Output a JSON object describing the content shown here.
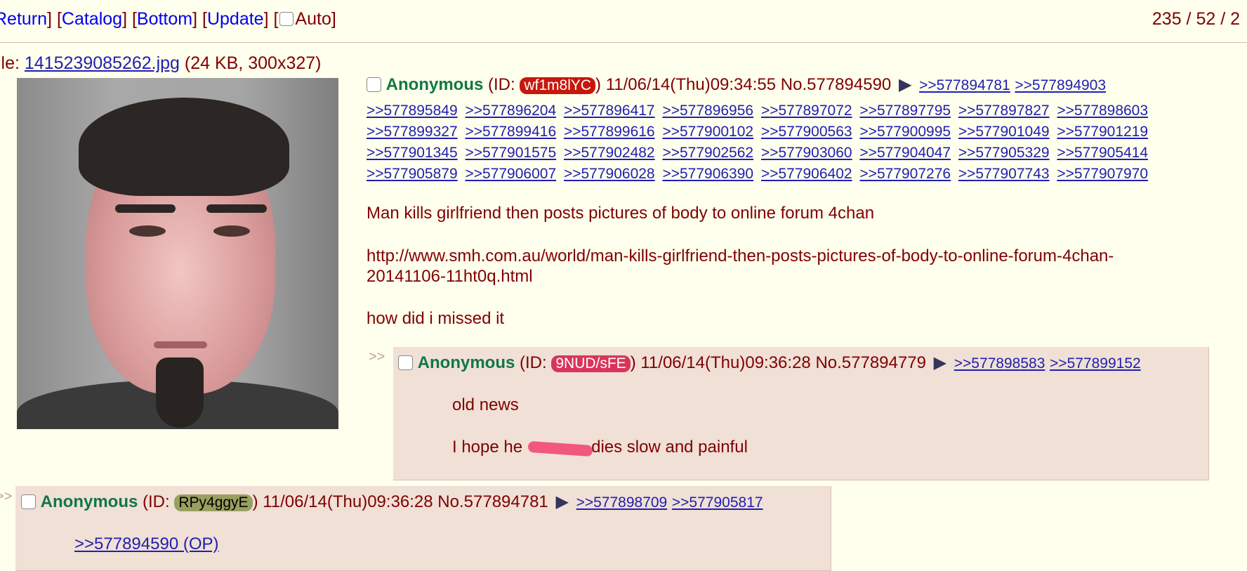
{
  "nav": {
    "return": "Return",
    "catalog": "Catalog",
    "bottom": "Bottom",
    "update": "Update",
    "auto": "Auto",
    "stats": "235 / 52 / 2"
  },
  "file": {
    "prefix": "ile: ",
    "filename": "1415239085262.jpg",
    "meta": "(24 KB, 300x327)"
  },
  "op": {
    "name": "Anonymous",
    "id_prefix": "(ID: ",
    "id": "wf1m8lYC",
    "id_color": "#c8170b",
    "datetime": ") 11/06/14(Thu)09:34:55",
    "postno": "No.577894590",
    "backlinks_first": [
      ">>577894781",
      ">>577894903"
    ],
    "backlinks": [
      ">>577895849",
      ">>577896204",
      ">>577896417",
      ">>577896956",
      ">>577897072",
      ">>577897795",
      ">>577897827",
      ">>577898603",
      ">>577899327",
      ">>577899416",
      ">>577899616",
      ">>577900102",
      ">>577900563",
      ">>577900995",
      ">>577901049",
      ">>577901219",
      ">>577901345",
      ">>577901575",
      ">>577902482",
      ">>577902562",
      ">>577903060",
      ">>577904047",
      ">>577905329",
      ">>577905414",
      ">>577905879",
      ">>577906007",
      ">>577906028",
      ">>577906390",
      ">>577906402",
      ">>577907276",
      ">>577907743",
      ">>577907970"
    ],
    "headline": "Man kills girlfriend then posts pictures of body to online forum 4chan",
    "url_line1": "http://www.smh.com.au/world/man-kills-girlfriend-then-posts-pictures-of-body-to-online-forum-4chan-",
    "url_line2": "20141106-11ht0q.html",
    "comment": "how did i missed it"
  },
  "reply1": {
    "arrows": ">>",
    "name": "Anonymous",
    "id_prefix": "(ID: ",
    "id": "9NUD/sFE",
    "id_color": "#d9355b",
    "datetime": ") 11/06/14(Thu)09:36:28",
    "postno": "No.577894779",
    "backlinks": [
      ">>577898583",
      ">>577899152"
    ],
    "line1": "old news",
    "line2_a": "I hope he",
    "line2_b": "dies slow and painful"
  },
  "reply2": {
    "arrows": ">>",
    "name": "Anonymous",
    "id_prefix": "(ID: ",
    "id": "RPy4ggyE",
    "id_color": "#98a060",
    "datetime": ") 11/06/14(Thu)09:36:28",
    "postno": "No.577894781",
    "backlinks": [
      ">>577898709",
      ">>577905817"
    ],
    "quote": ">>577894590 (OP)"
  }
}
